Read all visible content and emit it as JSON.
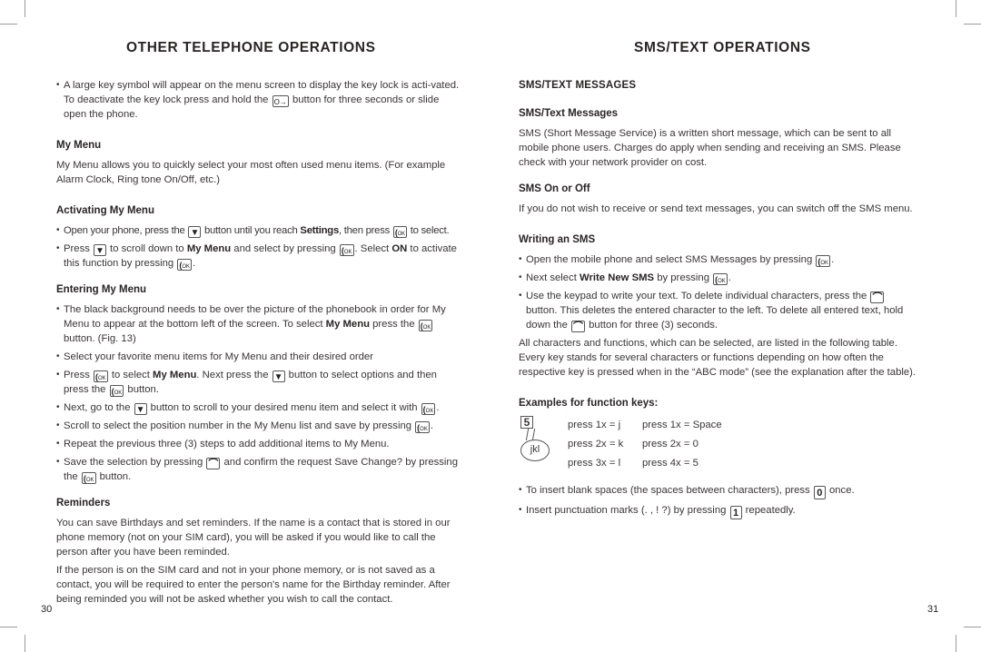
{
  "left_page": {
    "title": "OTHER TELEPHONE OPERATIONS",
    "page_number": "30",
    "intro_bullet": {
      "before": "A large key symbol will appear on the menu screen to display the key lock is acti-vated. To deactivate the key lock press and hold the ",
      "key": "lock-key",
      "after": " button for three seconds or slide open the phone."
    },
    "my_menu": {
      "heading": "My Menu",
      "text": "My Menu allows you to quickly select your most often used menu items. (For example Alarm Clock, Ring tone On/Off, etc.)"
    },
    "activating": {
      "heading": "Activating My Menu",
      "b1": {
        "t1": "Open your phone, press the ",
        "t2": " button until you reach ",
        "bold": "Settings",
        "t3": ", then press ",
        "t4": " to select."
      },
      "b2": {
        "t1": "Press ",
        "t2": " to scroll down to ",
        "bold1": "My Menu",
        "t3": " and select by pressing ",
        "t4": ". Select ",
        "bold2": "ON",
        "t5": " to activate this function by pressing ",
        "t6": "."
      }
    },
    "entering": {
      "heading": "Entering My Menu",
      "b1": {
        "t1": "The black background needs to be over the picture of the phonebook in order for My Menu to appear at the bottom left of the screen. To select ",
        "bold": "My Menu",
        "t2": " press the ",
        "t3": " button. (Fig. 13)"
      },
      "b2": "Select your favorite menu items for My Menu and their desired order",
      "b3": {
        "t1": "Press ",
        "t2": " to select ",
        "bold": "My Menu",
        "t3": ". Next press the ",
        "t4": "  button to select options and then press the ",
        "t5": "  button."
      },
      "b4": {
        "t1": "Next, go to the ",
        "t2": " button to scroll to your desired menu item and select it with ",
        "t3": "."
      },
      "b5": {
        "t1": "Scroll to select the position number in the My Menu list and save by pressing ",
        "t2": "."
      },
      "b6": "Repeat the previous three (3) steps to add additional items to My Menu.",
      "b7": {
        "t1": "Save the selection by pressing ",
        "t2": " and confirm the request Save Change? by pressing the ",
        "t3": " button."
      }
    },
    "reminders": {
      "heading": "Reminders",
      "p1": "You can save Birthdays and set reminders. If the name is a contact that is stored in our phone memory (not on your SIM card), you will be asked if you would like to call the person after you have been reminded.",
      "p2": "If the person is on the SIM card and not in your phone memory, or is not saved as a contact, you will be required to enter the person's name for the Birthday reminder. After being reminded you will not be asked whether you wish to call the contact."
    }
  },
  "right_page": {
    "title": "SMS/TEXT OPERATIONS",
    "page_number": "31",
    "section_heading": "SMS/TEXT MESSAGES",
    "sms_messages": {
      "heading": "SMS/Text Messages",
      "text": "SMS (Short Message Service) is a written short message, which can be sent to all mobile phone users. Charges do apply when sending and receiving an SMS. Please check with your network provider on cost."
    },
    "sms_on_off": {
      "heading": "SMS On or Off",
      "text": "If you do not wish to receive or send text messages, you can switch off the SMS menu."
    },
    "writing": {
      "heading": "Writing an SMS",
      "b1": {
        "t1": "Open the mobile phone and select SMS Messages by pressing ",
        "t2": "."
      },
      "b2": {
        "t1": "Next select ",
        "bold": "Write New SMS",
        "t2": " by pressing ",
        "t3": "."
      },
      "b3": {
        "t1": "Use the keypad to write your text. To delete individual characters, press the ",
        "t2": " button. This deletes the entered character to the left. To delete all entered text, hold down the ",
        "t3": " button for three (3) seconds."
      },
      "after": "All characters and functions, which can be selected, are listed in the following table. Every key stands for several characters or functions depending on how often the respective key is pressed when in the “ABC mode” (see the explanation after the table)."
    },
    "examples": {
      "heading": "Examples for function keys:",
      "key_label": "5",
      "bubble_label": "jkl",
      "col1": [
        "press 1x = j",
        "press 2x = k",
        "press 3x = l"
      ],
      "col2": [
        "press 1x = Space",
        "press 2x = 0",
        "press 4x = 5"
      ]
    },
    "tips": {
      "b1": {
        "t1": " To insert blank spaces (the spaces between characters), press ",
        "key": "0",
        "t2": " once."
      },
      "b2": {
        "t1": "Insert punctuation marks (. , ! ?) by pressing ",
        "key": "1",
        "t2": " repeatedly."
      }
    }
  }
}
